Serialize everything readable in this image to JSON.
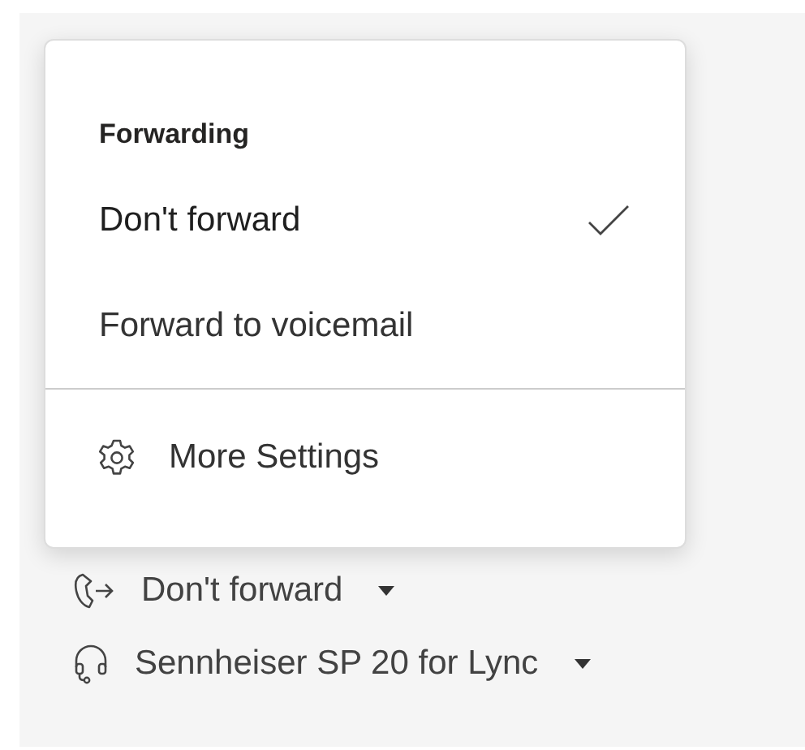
{
  "menu": {
    "heading": "Forwarding",
    "options": [
      {
        "label": "Don't forward",
        "selected": true
      },
      {
        "label": "Forward to voicemail",
        "selected": false
      }
    ],
    "settings": "More Settings"
  },
  "controls": [
    {
      "kind": "forward",
      "label": "Don't forward"
    },
    {
      "kind": "device",
      "label": "Sennheiser SP 20 for Lync"
    }
  ]
}
